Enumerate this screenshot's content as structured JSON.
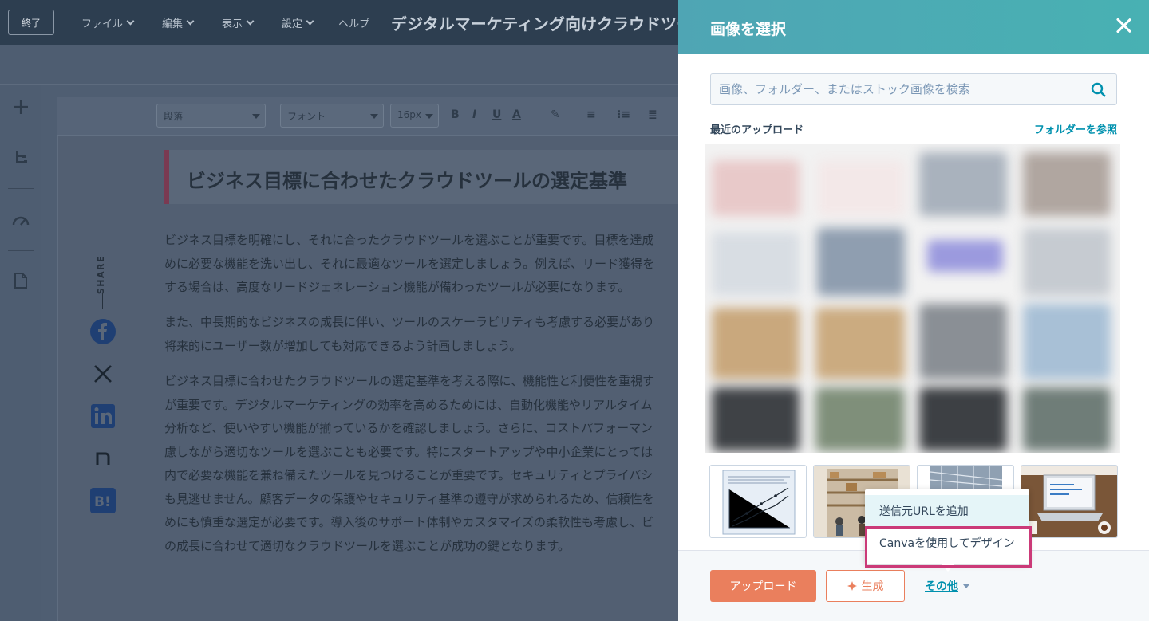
{
  "topbar": {
    "exit_label": "終了",
    "menus": [
      "ファイル",
      "編集",
      "表示",
      "設定",
      "ヘルプ"
    ],
    "doc_title": "デジタルマーケティング向けクラウドツー"
  },
  "toolbar": {
    "paragraph": "段落",
    "font": "フォント",
    "size": "16px",
    "bold": "B",
    "italic": "I",
    "underline": "U",
    "text_color": "A"
  },
  "article": {
    "heading": "ビジネス目標に合わせたクラウドツールの選定基準",
    "paragraphs": [
      [
        "ビジネス目標を明確にし、それに合ったクラウドツールを選ぶことが重要です。目標を達成",
        "めに必要な機能を洗い出し、それに最適なツールを選定しましょう。例えば、リード獲得を",
        "する場合は、高度なリードジェネレーション機能が備わったツールが必要になります。"
      ],
      [
        "また、中長期的なビジネスの成長に伴い、ツールのスケーラビリティも考慮する必要があり",
        "将来的にユーザー数が増加しても対応できるよう計画しましょう。"
      ],
      [
        "ビジネス目標に合わせたクラウドツールの選定基準を考える際に、機能性と利便性を重視す",
        "が重要です。デジタルマーケティングの効率を高めるためには、自動化機能やリアルタイム",
        "分析など、使いやすい機能が揃っているかを確認しましょう。さらに、コストパフォーマン",
        "慮しながら適切なツールを選ぶことも必要です。特にスタートアップや中小企業にとっては",
        "内で必要な機能を兼ね備えたツールを見つけることが重要です。セキュリティとプライバシ",
        "も見逃せません。顧客データの保護やセキュリティ基準の遵守が求められるため、信頼性を",
        "めにも慎重な選定が必要です。導入後のサポート体制やカスタマイズの柔軟性も考慮し、ビ",
        "の成長に合わせて適切なクラウドツールを選ぶことが成功の鍵となります。"
      ]
    ],
    "share_label": "SHARE"
  },
  "panel": {
    "title": "画像を選択",
    "search_placeholder": "画像、フォルダー、またはストック画像を検索",
    "recent_label": "最近のアップロード",
    "browse_label": "フォルダーを参照",
    "dropdown": {
      "items": [
        "送信元URLを追加",
        "Canvaを使用してデザイン"
      ]
    },
    "footer": {
      "upload": "アップロード",
      "generate": "生成",
      "more": "その他"
    }
  },
  "colors": {
    "panel_header": "#4fa5b4",
    "accent_orange": "#ea7f5d",
    "link_teal": "#0091ae",
    "highlight": "#cb3a78"
  }
}
